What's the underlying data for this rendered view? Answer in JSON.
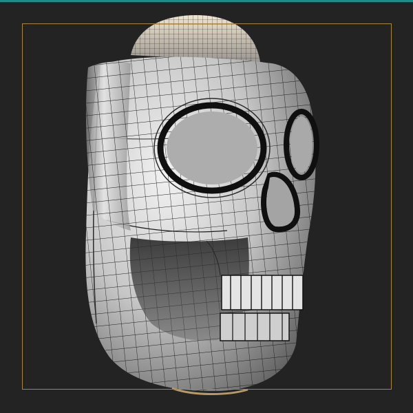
{
  "viewport": {
    "background": "#232323",
    "accent_color": "#1c8f8a",
    "safe_frame_color": "#a8863c"
  },
  "model": {
    "subject": "skull-mesh-wireframe",
    "shading": "shaded-with-wireframe",
    "surface_color": "#c9c9c9",
    "wire_color": "#1a1a1a"
  }
}
